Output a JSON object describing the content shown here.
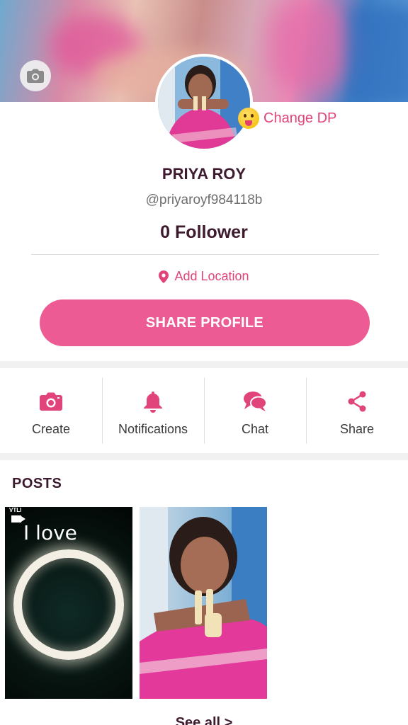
{
  "profile": {
    "change_dp_label": "Change DP",
    "name": "PRIYA ROY",
    "handle": "@priyaroyf984118b",
    "followers": "0 Follower",
    "add_location": "Add Location",
    "share_profile": "SHARE PROFILE"
  },
  "actions": [
    {
      "label": "Create",
      "icon": "camera-icon"
    },
    {
      "label": "Notifications",
      "icon": "bell-icon"
    },
    {
      "label": "Chat",
      "icon": "chat-icon"
    },
    {
      "label": "Share",
      "icon": "share-icon"
    }
  ],
  "posts": {
    "title": "POSTS",
    "items": [
      {
        "overlay_text": "I love",
        "type": "video",
        "tag": "VTLI"
      },
      {
        "overlay_text": "",
        "type": "photo"
      }
    ],
    "see_all": "See all >"
  },
  "colors": {
    "accent": "#ec5b93",
    "accent_text": "#e0447a",
    "title_text": "#3d1a2e"
  }
}
